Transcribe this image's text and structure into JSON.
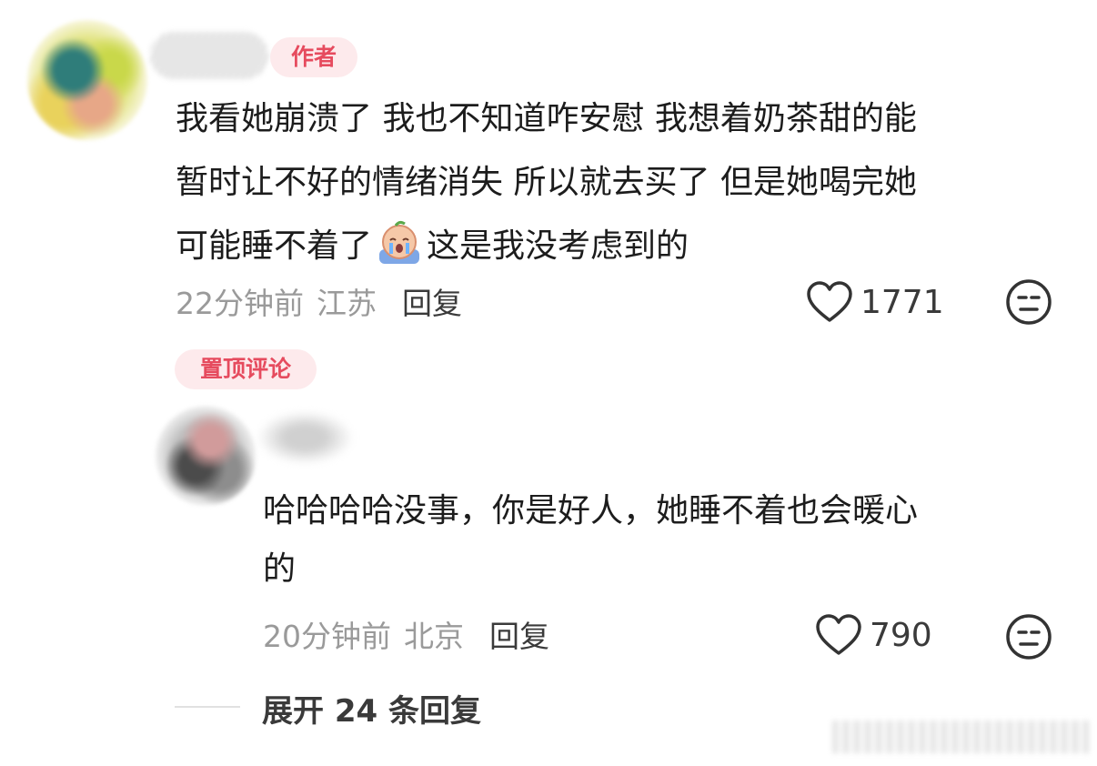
{
  "comment1": {
    "badge": "作者",
    "lines": [
      "我看她崩溃了 我也不知道咋安慰 我想着奶茶甜的能",
      "暂时让不好的情绪消失 所以就去买了 但是她喝完她",
      "可能睡不着了",
      "这是我没考虑到的"
    ],
    "time": "22分钟前",
    "location": "江苏",
    "reply_label": "回复",
    "likes": "1771"
  },
  "pinned_badge": "置顶评论",
  "comment2": {
    "lines": [
      "哈哈哈哈没事，你是好人，她睡不着也会暖心",
      "的"
    ],
    "time": "20分钟前",
    "location": "北京",
    "reply_label": "回复",
    "likes": "790"
  },
  "expand_label": "展开 24 条回复",
  "colors": {
    "badge_bg": "#fdeaec",
    "badge_text": "#e64b5e",
    "meta_text": "#9a9a9a"
  },
  "icons": [
    "heart-icon",
    "meh-face-icon",
    "crying-emoji-icon"
  ]
}
